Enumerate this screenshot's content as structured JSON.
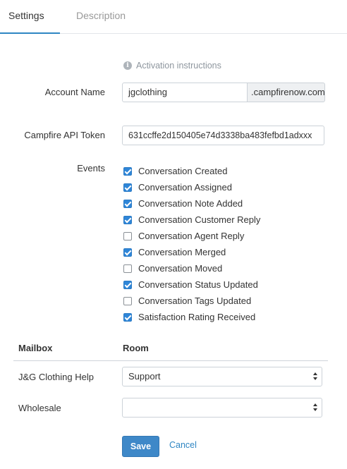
{
  "tabs": [
    {
      "label": "Settings",
      "active": true
    },
    {
      "label": "Description",
      "active": false
    }
  ],
  "activation": {
    "label": "Activation instructions",
    "icon": "info-icon"
  },
  "account": {
    "label": "Account Name",
    "value": "jgclothing",
    "suffix": ".campfirenow.com"
  },
  "token": {
    "label": "Campfire API Token",
    "value": "631ccffe2d150405e74d3338ba483fefbd1adxxx"
  },
  "events": {
    "label": "Events",
    "items": [
      {
        "label": "Conversation Created",
        "checked": true
      },
      {
        "label": "Conversation Assigned",
        "checked": true
      },
      {
        "label": "Conversation Note Added",
        "checked": true
      },
      {
        "label": "Conversation Customer Reply",
        "checked": true
      },
      {
        "label": "Conversation Agent Reply",
        "checked": false
      },
      {
        "label": "Conversation Merged",
        "checked": true
      },
      {
        "label": "Conversation Moved",
        "checked": false
      },
      {
        "label": "Conversation Status Updated",
        "checked": true
      },
      {
        "label": "Conversation Tags Updated",
        "checked": false
      },
      {
        "label": "Satisfaction Rating Received",
        "checked": true
      }
    ]
  },
  "mailboxes": {
    "header_mailbox": "Mailbox",
    "header_room": "Room",
    "rows": [
      {
        "name": "J&G Clothing Help",
        "room": "Support"
      },
      {
        "name": "Wholesale",
        "room": ""
      }
    ]
  },
  "actions": {
    "save": "Save",
    "cancel": "Cancel"
  },
  "colors": {
    "accent": "#2f86c3",
    "checkbox": "#2f86d8",
    "save_button": "#3e88c8"
  }
}
